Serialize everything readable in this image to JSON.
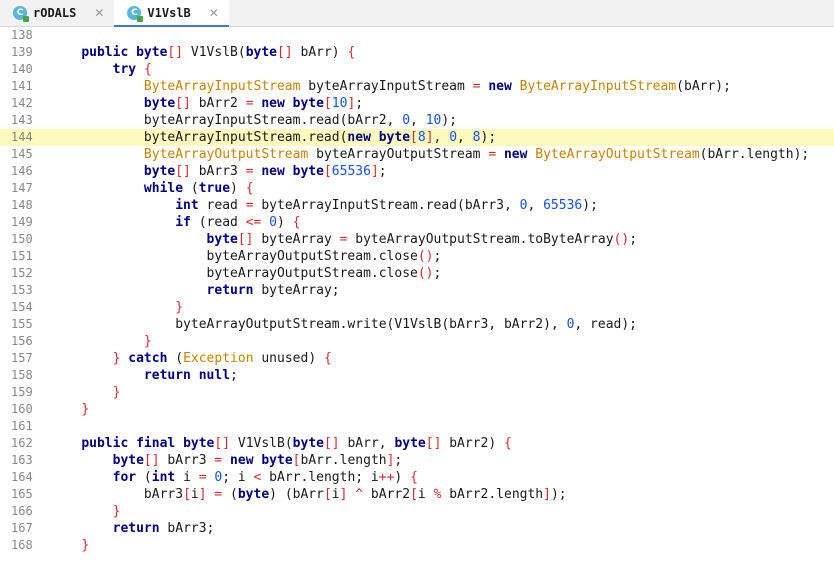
{
  "tabs": [
    {
      "label": "rODALS",
      "icon": "class-icon",
      "icon_letter": "C",
      "active": false
    },
    {
      "label": "V1VslB",
      "icon": "class-icon",
      "icon_letter": "C",
      "active": true
    }
  ],
  "lines": [
    {
      "no": "138",
      "code": ""
    },
    {
      "no": "139",
      "code": "    <k>public</k> <k>byte</k><p>[]</p> V1VslB(<k>byte</k><p>[]</p> bArr) <p>{</p>"
    },
    {
      "no": "140",
      "code": "        <k>try</k> <p>{</p>"
    },
    {
      "no": "141",
      "code": "            <t>ByteArrayInputStream</t> byteArrayInputStream <o>=</o> <k>new</k> <t>ByteArrayInputStream</t>(bArr);"
    },
    {
      "no": "142",
      "code": "            <k>byte</k><p>[]</p> bArr2 <o>=</o> <k>new</k> <k>byte</k><p>[</p><n>10</n><p>]</p>;"
    },
    {
      "no": "143",
      "code": "            byteArrayInputStream.read(bArr2, <n>0</n>, <n>10</n>);"
    },
    {
      "no": "144",
      "code": "            byteArrayInputStream.read(<k>new</k> <k>byte</k><p>[</p><n>8</n><p>]</p>, <n>0</n>, <n>8</n>);",
      "hl": true
    },
    {
      "no": "145",
      "code": "            <t>ByteArrayOutputStream</t> byteArrayOutputStream <o>=</o> <k>new</k> <t>ByteArrayOutputStream</t>(bArr.length);"
    },
    {
      "no": "146",
      "code": "            <k>byte</k><p>[]</p> bArr3 <o>=</o> <k>new</k> <k>byte</k><p>[</p><n>65536</n><p>]</p>;"
    },
    {
      "no": "147",
      "code": "            <k>while</k> (<k>true</k>) <p>{</p>"
    },
    {
      "no": "148",
      "code": "                <k>int</k> read <o>=</o> byteArrayInputStream.read(bArr3, <n>0</n>, <n>65536</n>);"
    },
    {
      "no": "149",
      "code": "                <k>if</k> (read <o>&lt;=</o> <n>0</n>) <p>{</p>"
    },
    {
      "no": "150",
      "code": "                    <k>byte</k><p>[]</p> byteArray <o>=</o> byteArrayOutputStream.toByteArray<p>()</p>;"
    },
    {
      "no": "151",
      "code": "                    byteArrayOutputStream.close<p>()</p>;"
    },
    {
      "no": "152",
      "code": "                    byteArrayOutputStream.close<p>()</p>;"
    },
    {
      "no": "153",
      "code": "                    <k>return</k> byteArray;"
    },
    {
      "no": "154",
      "code": "                <p>}</p>"
    },
    {
      "no": "155",
      "code": "                byteArrayOutputStream.write(V1VslB(bArr3, bArr2), <n>0</n>, read);"
    },
    {
      "no": "156",
      "code": "            <p>}</p>"
    },
    {
      "no": "157",
      "code": "        <p>}</p> <k>catch</k> (<t>Exception</t> unused) <p>{</p>"
    },
    {
      "no": "158",
      "code": "            <k>return</k> <k>null</k>;"
    },
    {
      "no": "159",
      "code": "        <p>}</p>"
    },
    {
      "no": "160",
      "code": "    <p>}</p>"
    },
    {
      "no": "161",
      "code": ""
    },
    {
      "no": "162",
      "code": "    <k>public</k> <k>final</k> <k>byte</k><p>[]</p> V1VslB(<k>byte</k><p>[]</p> bArr, <k>byte</k><p>[]</p> bArr2) <p>{</p>"
    },
    {
      "no": "163",
      "code": "        <k>byte</k><p>[]</p> bArr3 <o>=</o> <k>new</k> <k>byte</k><p>[</p>bArr.length<p>]</p>;"
    },
    {
      "no": "164",
      "code": "        <k>for</k> (<k>int</k> i <o>=</o> <n>0</n>; i <o>&lt;</o> bArr.length; i<o>++</o>) <p>{</p>"
    },
    {
      "no": "165",
      "code": "            bArr3<p>[</p>i<p>]</p> <o>=</o> (<k>byte</k>) (bArr<p>[</p>i<p>]</p> <o>^</o> bArr2<p>[</p>i <o>%</o> bArr2.length<p>]</p>);"
    },
    {
      "no": "166",
      "code": "        <p>}</p>"
    },
    {
      "no": "167",
      "code": "        <k>return</k> bArr3;"
    },
    {
      "no": "168",
      "code": "    <p>}</p>"
    }
  ],
  "colors": {
    "keyword": "#000080",
    "type": "#c58300",
    "number": "#1750eb",
    "punct": "#d12f2f",
    "highlight": "#fcfabd",
    "tab_underline": "#3b7bd8"
  }
}
